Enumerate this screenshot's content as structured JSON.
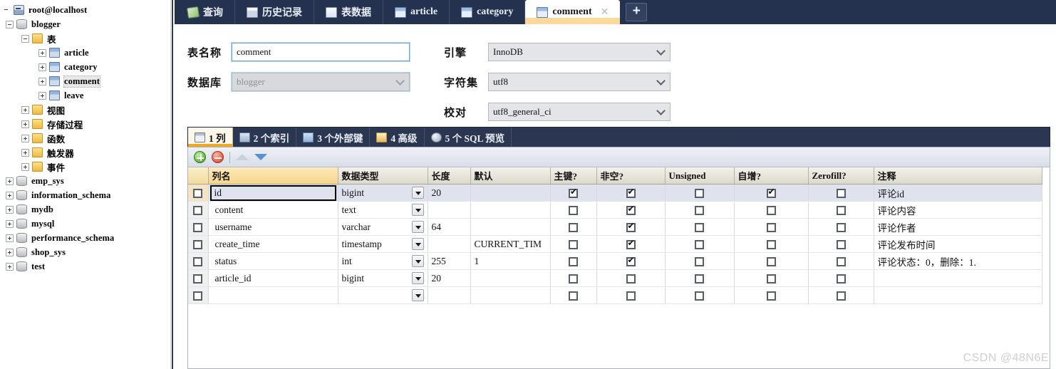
{
  "sidebar": {
    "nodes": [
      {
        "label": "root@localhost",
        "level": 0,
        "icon": "server-icon",
        "expander": "none",
        "selected": false
      },
      {
        "label": "blogger",
        "level": 1,
        "icon": "database-icon",
        "expander": "minus",
        "selected": false
      },
      {
        "label": "表",
        "level": 2,
        "icon": "folder-icon",
        "expander": "minus",
        "selected": false
      },
      {
        "label": "article",
        "level": 3,
        "icon": "table-icon",
        "expander": "plus",
        "selected": false
      },
      {
        "label": "category",
        "level": 3,
        "icon": "table-icon",
        "expander": "plus",
        "selected": false
      },
      {
        "label": "comment",
        "level": 3,
        "icon": "table-icon",
        "expander": "plus",
        "selected": true
      },
      {
        "label": "leave",
        "level": 3,
        "icon": "table-icon",
        "expander": "plus",
        "selected": false
      },
      {
        "label": "视图",
        "level": 2,
        "icon": "folder-icon",
        "expander": "plus",
        "selected": false
      },
      {
        "label": "存储过程",
        "level": 2,
        "icon": "folder-icon",
        "expander": "plus",
        "selected": false
      },
      {
        "label": "函数",
        "level": 2,
        "icon": "folder-icon",
        "expander": "plus",
        "selected": false
      },
      {
        "label": "触发器",
        "level": 2,
        "icon": "folder-icon",
        "expander": "plus",
        "selected": false
      },
      {
        "label": "事件",
        "level": 2,
        "icon": "folder-icon",
        "expander": "plus",
        "selected": false
      },
      {
        "label": "emp_sys",
        "level": 1,
        "icon": "database-icon",
        "expander": "plus",
        "selected": false
      },
      {
        "label": "information_schema",
        "level": 1,
        "icon": "database-icon",
        "expander": "plus",
        "selected": false
      },
      {
        "label": "mydb",
        "level": 1,
        "icon": "database-icon",
        "expander": "plus",
        "selected": false
      },
      {
        "label": "mysql",
        "level": 1,
        "icon": "database-icon",
        "expander": "plus",
        "selected": false
      },
      {
        "label": "performance_schema",
        "level": 1,
        "icon": "database-icon",
        "expander": "plus",
        "selected": false
      },
      {
        "label": "shop_sys",
        "level": 1,
        "icon": "database-icon",
        "expander": "plus",
        "selected": false
      },
      {
        "label": "test",
        "level": 1,
        "icon": "database-icon",
        "expander": "plus",
        "selected": false
      }
    ]
  },
  "tabs": {
    "items": [
      {
        "label": "查询",
        "icon": "query-icon",
        "active": false,
        "closable": false
      },
      {
        "label": "历史记录",
        "icon": "history-icon",
        "active": false,
        "closable": false
      },
      {
        "label": "表数据",
        "icon": "table-data-icon",
        "active": false,
        "closable": false
      },
      {
        "label": "article",
        "icon": "table-icon",
        "active": false,
        "closable": false
      },
      {
        "label": "category",
        "icon": "table-icon",
        "active": false,
        "closable": false
      },
      {
        "label": "comment",
        "icon": "table-icon",
        "active": true,
        "closable": true
      }
    ],
    "close_glyph": "✕",
    "add_label": "+"
  },
  "form": {
    "table_name_label": "表名称",
    "table_name_value": "comment",
    "database_label": "数据库",
    "database_value": "blogger",
    "engine_label": "引擎",
    "engine_value": "InnoDB",
    "charset_label": "字符集",
    "charset_value": "utf8",
    "collation_label": "校对",
    "collation_value": "utf8_general_ci"
  },
  "subtabs": {
    "items": [
      {
        "label": "1 列",
        "icon": "columns-icon",
        "active": true
      },
      {
        "label": "2 个索引",
        "icon": "index-icon",
        "active": false
      },
      {
        "label": "3 个外部键",
        "icon": "foreign-key-icon",
        "active": false
      },
      {
        "label": "4 高级",
        "icon": "advanced-icon",
        "active": false
      },
      {
        "label": "5 个 SQL 预览",
        "icon": "sql-preview-icon",
        "active": false
      }
    ]
  },
  "toolbar": {
    "add_title": "添加栏位",
    "delete_title": "删除栏位",
    "move_up_title": "上移",
    "move_down_title": "下移"
  },
  "grid": {
    "headers": [
      "列名",
      "数据类型",
      "长度",
      "默认",
      "主键?",
      "非空?",
      "Unsigned",
      "自增?",
      "Zerofill?",
      "注释"
    ],
    "rows": [
      {
        "name": "id",
        "type": "bigint",
        "length": "20",
        "default": "",
        "pk": true,
        "notnull": true,
        "unsigned": false,
        "autoinc": true,
        "zerofill": false,
        "comment": "评论id",
        "selected": true,
        "checked": false
      },
      {
        "name": "content",
        "type": "text",
        "length": "",
        "default": "",
        "pk": false,
        "notnull": true,
        "unsigned": false,
        "autoinc": false,
        "zerofill": false,
        "comment": "评论内容",
        "selected": false,
        "checked": false
      },
      {
        "name": "username",
        "type": "varchar",
        "length": "64",
        "default": "",
        "pk": false,
        "notnull": true,
        "unsigned": false,
        "autoinc": false,
        "zerofill": false,
        "comment": "评论作者",
        "selected": false,
        "checked": false
      },
      {
        "name": "create_time",
        "type": "timestamp",
        "length": "",
        "default": "CURRENT_TIM",
        "pk": false,
        "notnull": true,
        "unsigned": false,
        "autoinc": false,
        "zerofill": false,
        "comment": "评论发布时间",
        "selected": false,
        "checked": false
      },
      {
        "name": "status",
        "type": "int",
        "length": "255",
        "default": "1",
        "pk": false,
        "notnull": true,
        "unsigned": false,
        "autoinc": false,
        "zerofill": false,
        "comment": "评论状态：0，删除：1.",
        "selected": false,
        "checked": false
      },
      {
        "name": "article_id",
        "type": "bigint",
        "length": "20",
        "default": "",
        "pk": false,
        "notnull": false,
        "unsigned": false,
        "autoinc": false,
        "zerofill": false,
        "comment": "",
        "selected": false,
        "checked": false
      },
      {
        "name": "",
        "type": "",
        "length": "",
        "default": "",
        "pk": false,
        "notnull": false,
        "unsigned": false,
        "autoinc": false,
        "zerofill": false,
        "comment": "",
        "selected": false,
        "checked": false
      }
    ]
  },
  "watermark": "CSDN @48N6E",
  "colors": {
    "tabbar_bg": "#243250",
    "active_tab_strip": "#fcd99a",
    "subtab_active_underline": "#f0a726",
    "colname_header": "#f6d68c",
    "selected_row": "#dfe3ee"
  }
}
